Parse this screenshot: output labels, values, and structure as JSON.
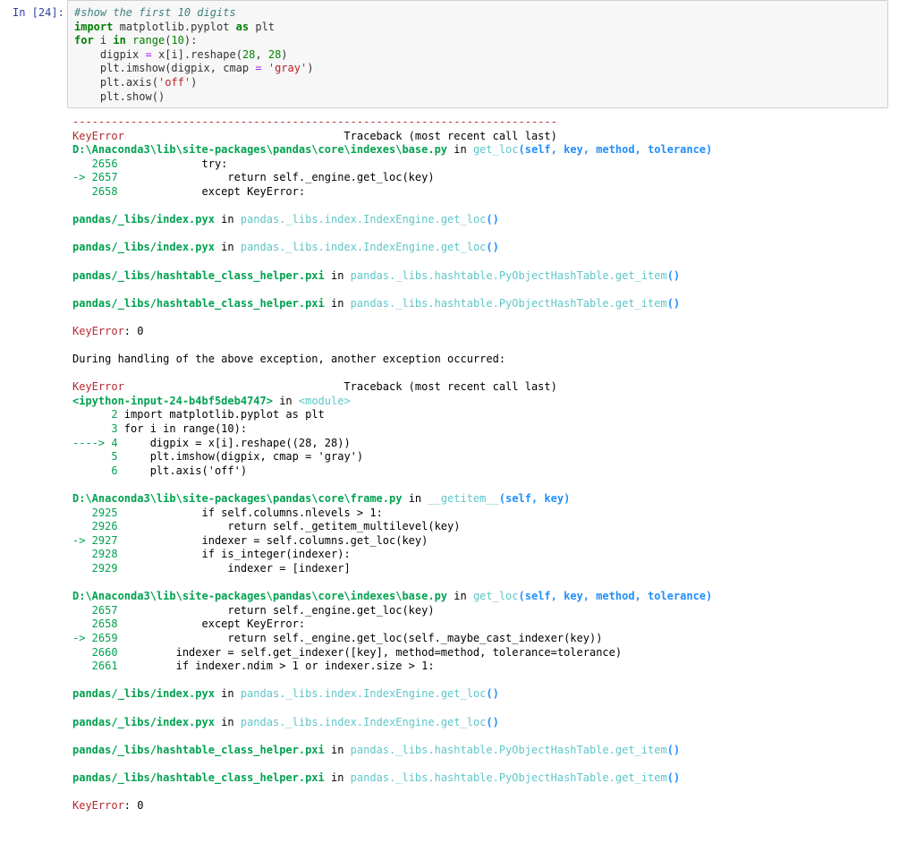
{
  "cell": {
    "prompt": "In [24]:",
    "code_lines": [
      "#show the first 10 digits",
      "import matplotlib.pyplot as plt",
      "for i in range(10):",
      "    digpix = x[i].reshape(28, 28)",
      "    plt.imshow(digpix, cmap = 'gray')",
      "    plt.axis('off')",
      "    plt.show()"
    ]
  },
  "output": {
    "separator": "---------------------------------------------------------------------------",
    "lines": [
      "KeyError                                  Traceback (most recent call last)",
      "D:\\Anaconda3\\lib\\site-packages\\pandas\\core\\indexes\\base.py in get_loc(self, key, method, tolerance)",
      "   2656             try:",
      "-> 2657                 return self._engine.get_loc(key)",
      "   2658             except KeyError:",
      "",
      "pandas/_libs/index.pyx in pandas._libs.index.IndexEngine.get_loc()",
      "",
      "pandas/_libs/index.pyx in pandas._libs.index.IndexEngine.get_loc()",
      "",
      "pandas/_libs/hashtable_class_helper.pxi in pandas._libs.hashtable.PyObjectHashTable.get_item()",
      "",
      "pandas/_libs/hashtable_class_helper.pxi in pandas._libs.hashtable.PyObjectHashTable.get_item()",
      "",
      "KeyError: 0",
      "",
      "During handling of the above exception, another exception occurred:",
      "",
      "KeyError                                  Traceback (most recent call last)",
      "<ipython-input-24-b4bf5deb4747> in <module>",
      "      2 import matplotlib.pyplot as plt",
      "      3 for i in range(10):",
      "----> 4     digpix = x[i].reshape((28, 28))",
      "      5     plt.imshow(digpix, cmap = 'gray')",
      "      6     plt.axis('off')",
      "",
      "D:\\Anaconda3\\lib\\site-packages\\pandas\\core\\frame.py in __getitem__(self, key)",
      "   2925             if self.columns.nlevels > 1:",
      "   2926                 return self._getitem_multilevel(key)",
      "-> 2927             indexer = self.columns.get_loc(key)",
      "   2928             if is_integer(indexer):",
      "   2929                 indexer = [indexer]",
      "",
      "D:\\Anaconda3\\lib\\site-packages\\pandas\\core\\indexes\\base.py in get_loc(self, key, method, tolerance)",
      "   2657                 return self._engine.get_loc(key)",
      "   2658             except KeyError:",
      "-> 2659                 return self._engine.get_loc(self._maybe_cast_indexer(key))",
      "   2660         indexer = self.get_indexer([key], method=method, tolerance=tolerance)",
      "   2661         if indexer.ndim > 1 or indexer.size > 1:",
      "",
      "pandas/_libs/index.pyx in pandas._libs.index.IndexEngine.get_loc()",
      "",
      "pandas/_libs/index.pyx in pandas._libs.index.IndexEngine.get_loc()",
      "",
      "pandas/_libs/hashtable_class_helper.pxi in pandas._libs.hashtable.PyObjectHashTable.get_item()",
      "",
      "pandas/_libs/hashtable_class_helper.pxi in pandas._libs.hashtable.PyObjectHashTable.get_item()",
      "",
      "KeyError: 0"
    ]
  }
}
